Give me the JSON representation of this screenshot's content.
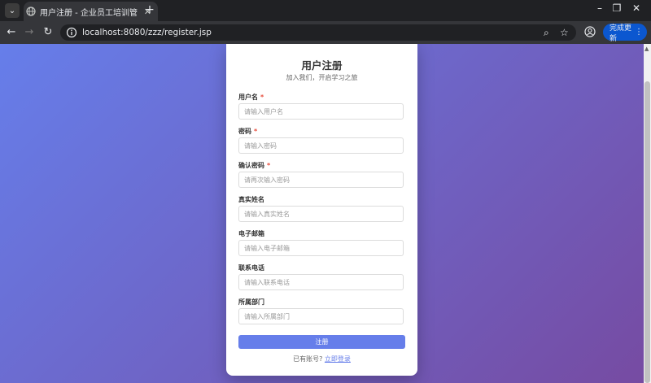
{
  "browser": {
    "tab_title": "用户注册 - 企业员工培训管理系统",
    "url": "localhost:8080/zzz/register.jsp",
    "update_button": "完成更新"
  },
  "form": {
    "title": "用户注册",
    "subtitle": "加入我们，开启学习之旅",
    "fields": [
      {
        "label": "用户名",
        "required": true,
        "placeholder": "请输入用户名"
      },
      {
        "label": "密码",
        "required": true,
        "placeholder": "请输入密码"
      },
      {
        "label": "确认密码",
        "required": true,
        "placeholder": "请再次输入密码"
      },
      {
        "label": "真实姓名",
        "required": false,
        "placeholder": "请输入真实姓名"
      },
      {
        "label": "电子邮箱",
        "required": false,
        "placeholder": "请输入电子邮箱"
      },
      {
        "label": "联系电话",
        "required": false,
        "placeholder": "请输入联系电话"
      },
      {
        "label": "所属部门",
        "required": false,
        "placeholder": "请输入所属部门"
      }
    ],
    "required_mark": "*",
    "submit_label": "注册",
    "login_prompt": "已有账号?",
    "login_link": "立即登录"
  }
}
